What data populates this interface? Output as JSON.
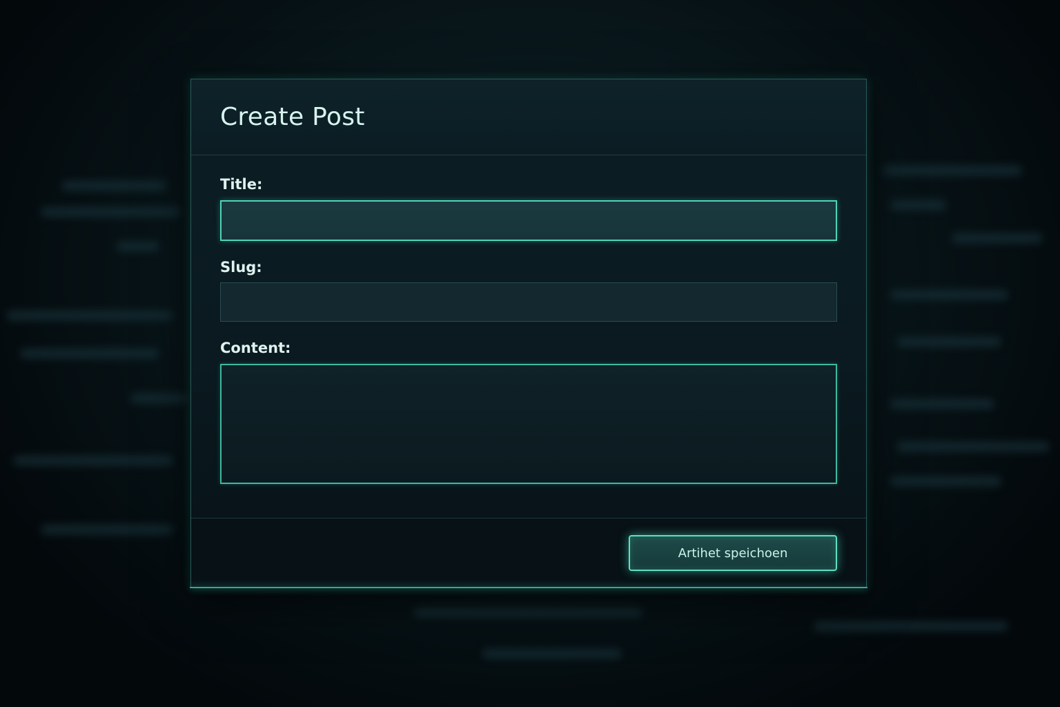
{
  "form": {
    "title": "Create Post",
    "fields": {
      "title": {
        "label": "Title:",
        "value": ""
      },
      "slug": {
        "label": "Slug:",
        "value": ""
      },
      "content": {
        "label": "Content:",
        "value": ""
      }
    },
    "save_label": "Artihet speichoen"
  },
  "colors": {
    "accent": "#4fd4b8",
    "background": "#03080c",
    "panel": "#0a1a20",
    "text": "#d6f3ee"
  }
}
